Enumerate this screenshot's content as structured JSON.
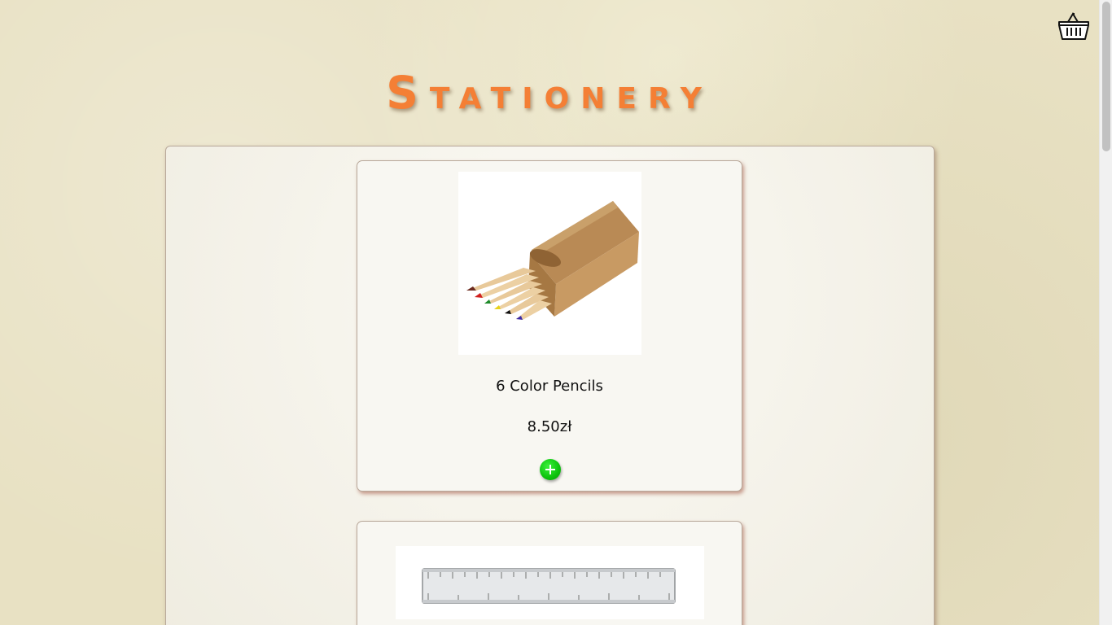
{
  "page": {
    "title": "Stationery",
    "title_first_letter": "S",
    "title_rest": "tationery"
  },
  "header": {
    "cart_icon": "basket-icon"
  },
  "products": [
    {
      "name": "6 Color Pencils",
      "price": "8.50zł",
      "image_icon": "color-pencils-box-image",
      "add_icon": "plus-icon"
    },
    {
      "name": "",
      "price": "",
      "image_icon": "ruler-image"
    }
  ],
  "colors": {
    "title": "#f47f35",
    "add_button": "#0cc20c",
    "background": "#e8e1c3"
  }
}
